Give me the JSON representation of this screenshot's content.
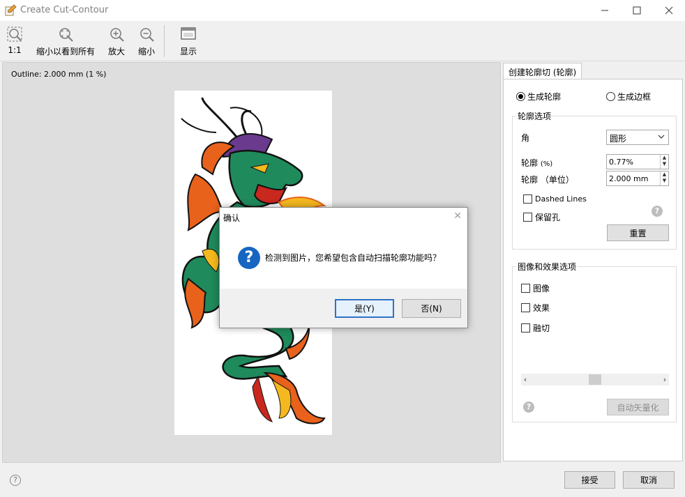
{
  "window": {
    "title": "Create Cut-Contour"
  },
  "toolbar": {
    "items": [
      {
        "label": "1:1",
        "icon": "zoom-actual-size-icon"
      },
      {
        "label": "缩小以看到所有",
        "icon": "zoom-fit-icon"
      },
      {
        "label": "放大",
        "icon": "zoom-in-icon"
      },
      {
        "label": "缩小",
        "icon": "zoom-out-icon"
      },
      {
        "label": "显示",
        "icon": "display-window-icon"
      }
    ]
  },
  "preview": {
    "outline_info": "Outline: 2.000 mm (1 %)",
    "image": "dragon-illustration"
  },
  "panel": {
    "tab_label": "创建轮廓切 (轮廓)",
    "radio_contour": "生成轮廓",
    "radio_frame": "生成边框",
    "radio_selected": "生成轮廓",
    "contour_group": {
      "title": "轮廓选项",
      "corner_label": "角",
      "corner_value": "圆形",
      "contour_pct_label": "轮廓",
      "contour_pct_unit": "(%)",
      "contour_pct_value": "0.77%",
      "contour_unit_label": "轮廓 （单位）",
      "contour_unit_value": "2.000 mm",
      "dashed_lines": "Dashed Lines",
      "keep_holes": "保留孔",
      "reset_button": "重置"
    },
    "effects_group": {
      "title": "图像和效果选项",
      "image": "图像",
      "effects": "效果",
      "weld": "融切",
      "auto_vectorize_button": "自动矢量化"
    }
  },
  "footer": {
    "accept_button": "接受",
    "cancel_button": "取消"
  },
  "dialog": {
    "title": "确认",
    "message": "检测到图片，您希望包含自动扫描轮廓功能吗？",
    "yes_button": "是(Y)",
    "no_button": "否(N)"
  },
  "colors": {
    "dialog_icon_blue": "#1665c1",
    "primary_button_border": "#2e72c4",
    "dragon_green": "#1f8a5b",
    "dragon_orange": "#e8621c",
    "dragon_yellow": "#f5b81e",
    "dragon_purple": "#6a3a8e",
    "dragon_red": "#c8281e"
  }
}
